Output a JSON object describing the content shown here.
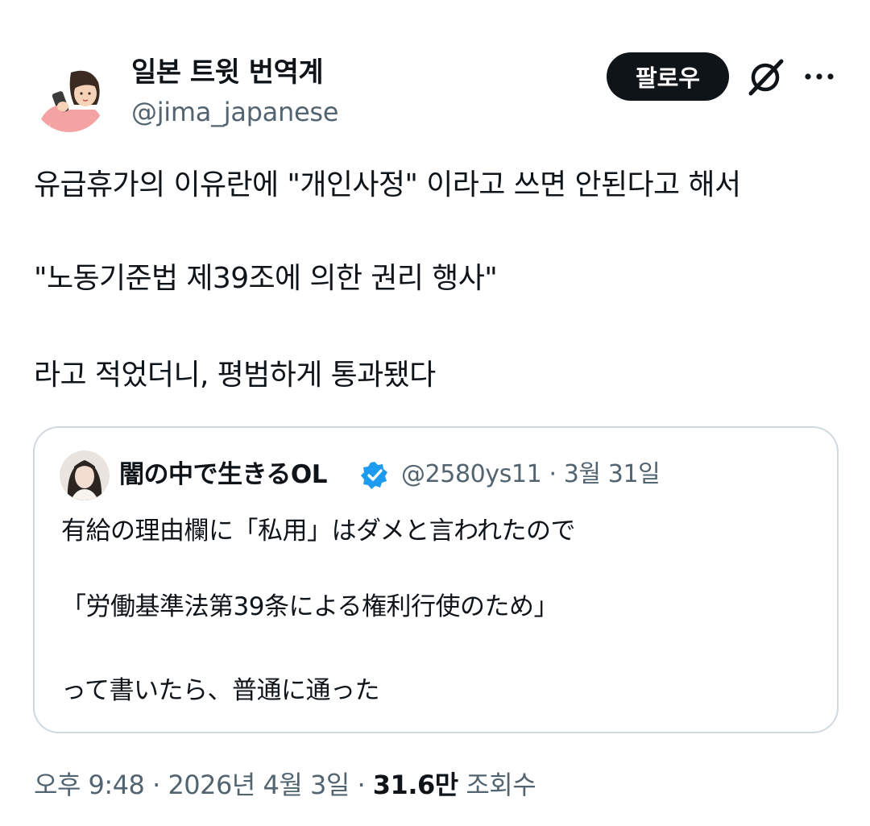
{
  "author": {
    "display_name": "일본 트윗 번역계",
    "handle": "@jima_japanese"
  },
  "actions": {
    "follow_label": "팔로우"
  },
  "icons": {
    "grok": "grok-icon",
    "more": "more-icon",
    "verified": "verified-badge-icon"
  },
  "tweet": {
    "lines": [
      "유급휴가의 이유란에 \"개인사정\" 이라고 쓰면 안된다고 해서",
      "\"노동기준법 제39조에 의한 권리 행사\"",
      "라고 적었더니, 평범하게 통과됐다"
    ]
  },
  "quote": {
    "display_name": "闇の中で生きるOL",
    "handle": "@2580ys11",
    "separator": " · ",
    "date": "3월 31일",
    "lines": [
      "有給の理由欄に「私用」はダメと言われたので",
      "「労働基準法第39条による権利行使のため」",
      "って書いたら、普通に通った"
    ]
  },
  "footer": {
    "time": "오후 9:48",
    "separator": " · ",
    "date": "2026년 4월 3일",
    "views_count": "31.6만",
    "views_label": " 조회수"
  },
  "colors": {
    "text": "#0f1419",
    "secondary": "#536471",
    "border": "#cfd9de",
    "verified": "#1d9bf0"
  }
}
